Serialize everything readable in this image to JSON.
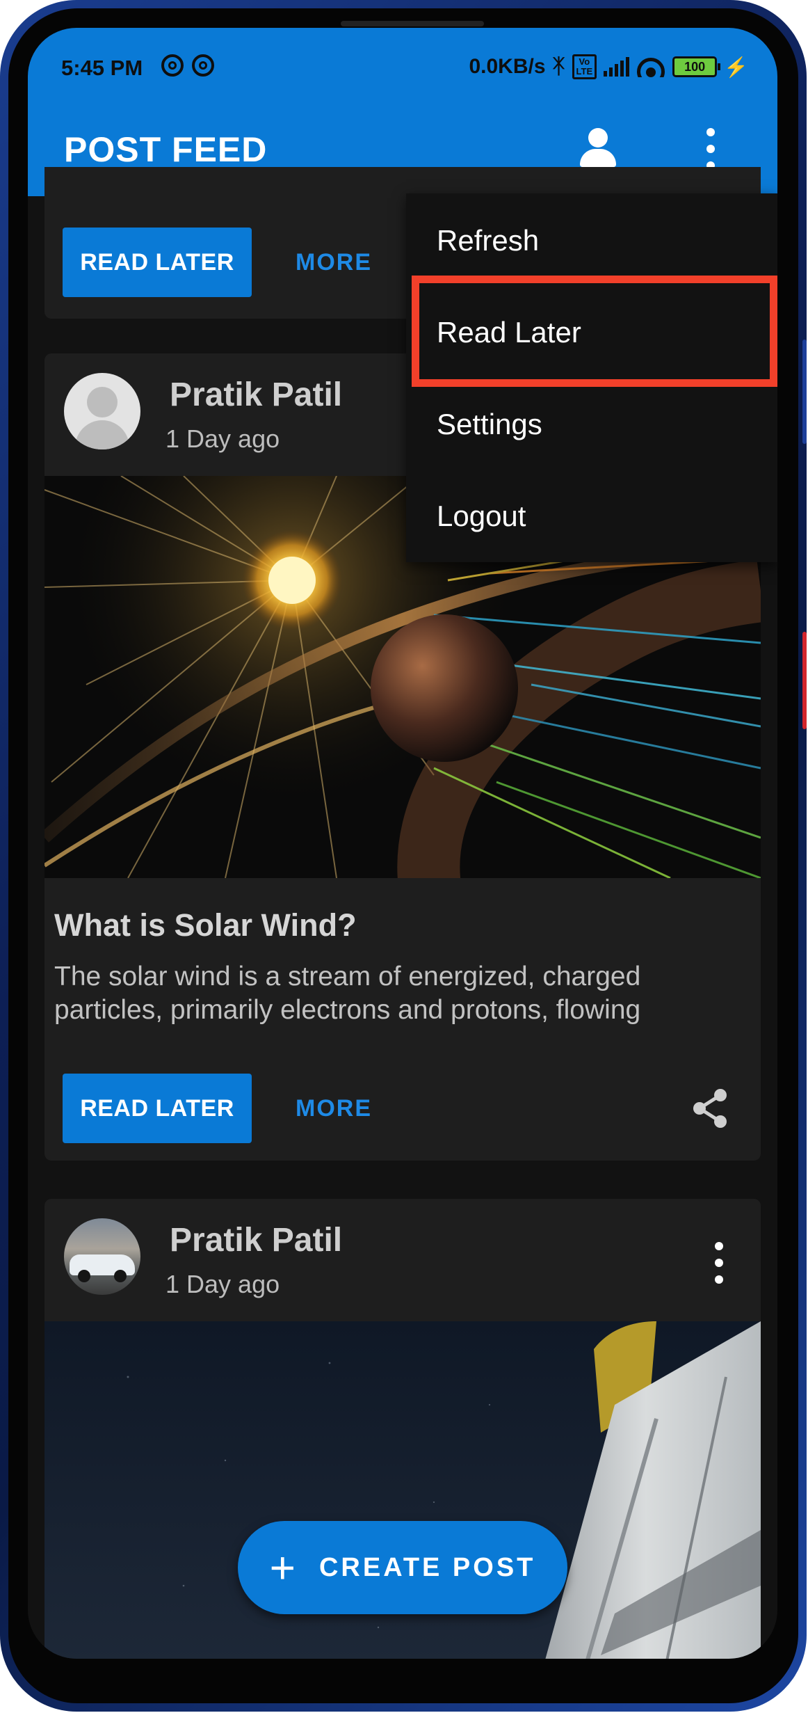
{
  "status_bar": {
    "time": "5:45 PM",
    "net_speed": "0.0KB/s",
    "volte_top": "Vo",
    "volte_bottom": "LTE",
    "battery": "100"
  },
  "app_bar": {
    "title": "POST FEED"
  },
  "menu": {
    "items": [
      "Refresh",
      "Read Later",
      "Settings",
      "Logout"
    ],
    "highlighted_item": "Read Later",
    "highlight_color": "#f2402a"
  },
  "actions": {
    "read_later_label": "READ LATER",
    "more_label": "MORE"
  },
  "posts": [
    {
      "author": "Pratik Patil",
      "time_ago": "1 Day ago",
      "title": "What is Solar Wind?",
      "excerpt": "The solar wind is a stream of energized, charged particles, primarily electrons and protons, flowing",
      "avatar_icon": "default-user-avatar"
    },
    {
      "author": "Pratik Patil",
      "time_ago": "1 Day ago",
      "avatar_icon": "car-avatar"
    }
  ],
  "fab": {
    "label": "CREATE POST",
    "icon": "plus-icon"
  },
  "colors": {
    "primary": "#0a7ad6",
    "background": "#121212",
    "card": "#1e1e1e",
    "accent_text": "#1e8ae6"
  }
}
